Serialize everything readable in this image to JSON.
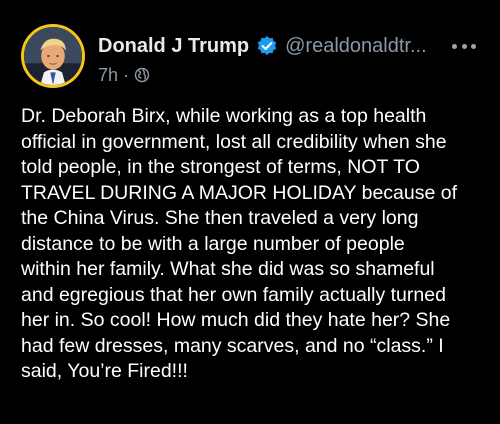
{
  "post": {
    "author": {
      "display_name": "Donald J Trump",
      "handle": "@realdonaldtr...",
      "verified": true,
      "avatar_icon": "profile-photo",
      "avatar_ring_color": "#f5c518"
    },
    "time": "7h",
    "separator": "·",
    "visibility_icon": "globe-icon",
    "more_icon": "more-options-icon",
    "text": "Dr. Deborah Birx, while working as a top health\nofficial in government, lost all credibility when she\ntold people, in the strongest of terms, NOT TO\nTRAVEL DURING A MAJOR HOLIDAY because of\nthe China Virus. She then traveled a very long\ndistance to be with a large number of people\nwithin her family. What she did was so shameful\nand egregious that her own family actually turned\nher in. So cool! How much did they hate her? She\nhad few dresses, many scarves, and no “class.” I\nsaid, You’re Fired!!!"
  },
  "colors": {
    "background": "#000000",
    "text": "#ffffff",
    "muted": "#8b98a5",
    "verified_badge": "#1d9bf0"
  }
}
